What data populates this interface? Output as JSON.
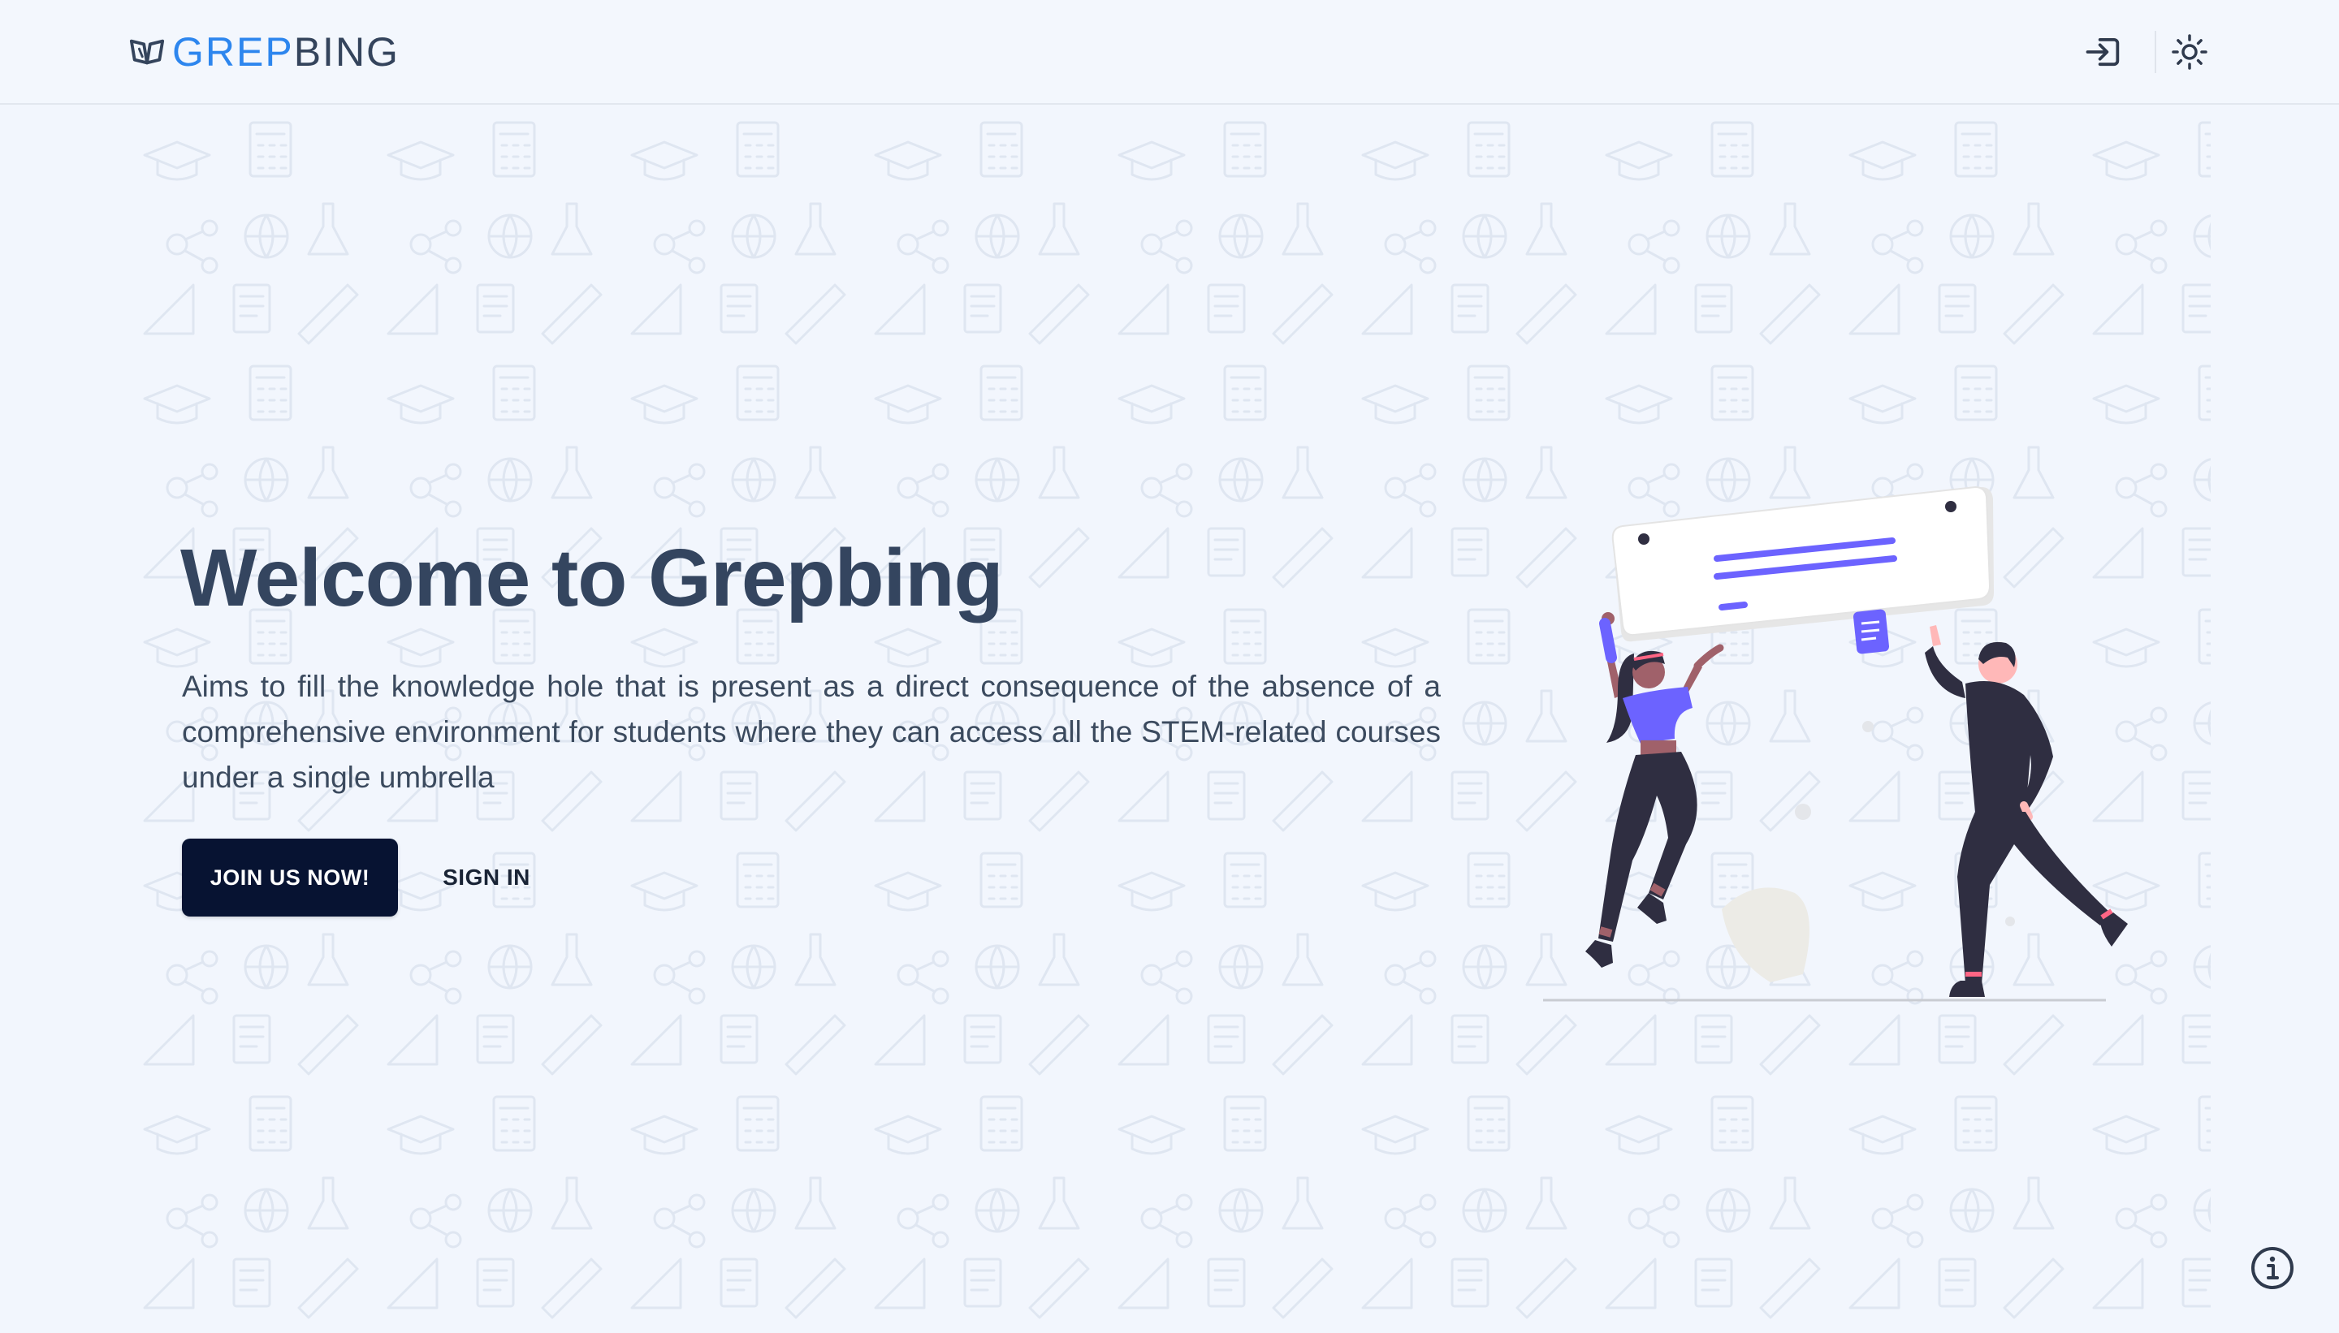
{
  "header": {
    "logo_text_part1": "GREP",
    "logo_text_part2": "BING",
    "logo_icon": "open-book-icon",
    "signin_icon": "login-icon",
    "theme_icon": "sun-icon"
  },
  "hero": {
    "title": "Welcome to Grepbing",
    "description": "Aims to fill the knowledge hole that is present as a direct consequence of the absence of a comprehensive environment for students where they can access all the STEM-related courses under a single umbrella",
    "join_label": "JOIN US NOW!",
    "signin_label": "SIGN IN"
  },
  "footer": {
    "info_icon": "info-icon"
  },
  "colors": {
    "background": "#f2f6fd",
    "brand_blue": "#2d86ee",
    "dark_text": "#34455f",
    "button_dark": "#071332",
    "accent_purple": "#6c63ff"
  }
}
